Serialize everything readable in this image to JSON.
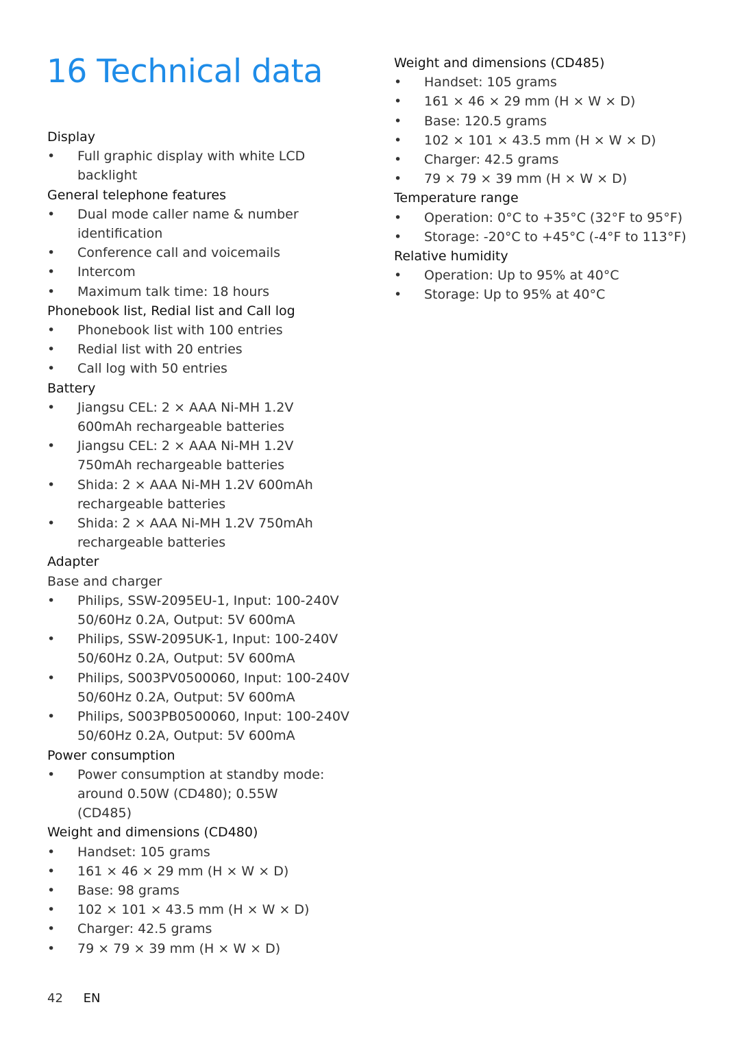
{
  "page_title": "16 Technical data",
  "left_column": [
    {
      "heading": "Display",
      "items": [
        {
          "type": "bullet",
          "text": "Full graphic display with white LCD backlight",
          "lines": [
            "Full graphic display with white LCD",
            "backlight"
          ]
        }
      ]
    },
    {
      "heading": "General telephone features",
      "items": [
        {
          "type": "bullet",
          "lines": [
            "Dual mode caller name & number",
            "identification"
          ]
        },
        {
          "type": "bullet",
          "lines": [
            "Conference call and voicemails"
          ]
        },
        {
          "type": "bullet",
          "lines": [
            "Intercom"
          ]
        },
        {
          "type": "bullet",
          "lines": [
            "Maximum talk time: 18 hours"
          ]
        }
      ]
    },
    {
      "heading": "Phonebook list, Redial list and Call log",
      "items": [
        {
          "type": "bullet",
          "lines": [
            "Phonebook list with 100 entries"
          ]
        },
        {
          "type": "bullet",
          "lines": [
            "Redial list with 20 entries"
          ]
        },
        {
          "type": "bullet",
          "lines": [
            "Call log with 50 entries"
          ]
        }
      ]
    },
    {
      "heading": "Battery",
      "items": [
        {
          "type": "bullet",
          "lines": [
            "Jiangsu CEL: 2 × AAA Ni-MH 1.2V",
            "600mAh rechargeable batteries"
          ]
        },
        {
          "type": "bullet",
          "lines": [
            "Jiangsu CEL: 2 × AAA Ni-MH 1.2V",
            "750mAh rechargeable batteries"
          ]
        },
        {
          "type": "bullet",
          "lines": [
            "Shida: 2 × AAA Ni-MH 1.2V 600mAh",
            "rechargeable batteries"
          ]
        },
        {
          "type": "bullet",
          "lines": [
            "Shida: 2 × AAA Ni-MH 1.2V 750mAh",
            "rechargeable batteries"
          ]
        }
      ]
    },
    {
      "heading": "Adapter",
      "items": [
        {
          "type": "plain",
          "lines": [
            "Base and charger"
          ]
        },
        {
          "type": "bullet",
          "lines": [
            "Philips, SSW-2095EU-1, Input: 100-240V",
            "50/60Hz 0.2A, Output: 5V 600mA"
          ]
        },
        {
          "type": "bullet",
          "lines": [
            "Philips, SSW-2095UK-1, Input: 100-240V",
            "50/60Hz 0.2A, Output: 5V 600mA"
          ]
        },
        {
          "type": "bullet",
          "lines": [
            "Philips, S003PV0500060, Input: 100-240V",
            "50/60Hz 0.2A, Output: 5V 600mA"
          ]
        },
        {
          "type": "bullet",
          "lines": [
            "Philips, S003PB0500060, Input: 100-240V",
            "50/60Hz 0.2A, Output: 5V 600mA"
          ]
        }
      ]
    },
    {
      "heading": "Power consumption",
      "items": [
        {
          "type": "bullet",
          "lines": [
            "Power consumption at standby mode:",
            "around 0.50W (CD480); 0.55W",
            "(CD485)"
          ]
        }
      ]
    },
    {
      "heading": "Weight and dimensions (CD480)",
      "items": [
        {
          "type": "bullet",
          "lines": [
            "Handset: 105 grams"
          ]
        },
        {
          "type": "bullet",
          "lines": [
            "161 × 46 × 29 mm (H × W × D)"
          ]
        },
        {
          "type": "bullet",
          "lines": [
            "Base: 98 grams"
          ]
        },
        {
          "type": "bullet",
          "lines": [
            "102 × 101 × 43.5 mm (H × W × D)"
          ]
        },
        {
          "type": "bullet",
          "lines": [
            "Charger: 42.5 grams"
          ]
        },
        {
          "type": "bullet",
          "lines": [
            "79 × 79 × 39 mm (H × W × D)"
          ]
        }
      ]
    }
  ],
  "right_column": [
    {
      "heading": "Weight and dimensions (CD485)",
      "items": [
        {
          "type": "bullet",
          "lines": [
            "Handset: 105 grams"
          ]
        },
        {
          "type": "bullet",
          "lines": [
            "161 × 46 × 29 mm (H × W × D)"
          ]
        },
        {
          "type": "bullet",
          "lines": [
            "Base: 120.5 grams"
          ]
        },
        {
          "type": "bullet",
          "lines": [
            "102 × 101 × 43.5 mm (H × W × D)"
          ]
        },
        {
          "type": "bullet",
          "lines": [
            "Charger: 42.5 grams"
          ]
        },
        {
          "type": "bullet",
          "lines": [
            "79 × 79 × 39 mm (H × W × D)"
          ]
        }
      ]
    },
    {
      "heading": "Temperature range",
      "items": [
        {
          "type": "bullet",
          "lines": [
            "Operation: 0°C to +35°C (32°F to 95°F)"
          ]
        },
        {
          "type": "bullet",
          "lines": [
            "Storage: -20°C to +45°C (-4°F to 113°F)"
          ]
        }
      ]
    },
    {
      "heading": "Relative humidity",
      "items": [
        {
          "type": "bullet",
          "lines": [
            "Operation: Up to 95% at 40°C"
          ]
        },
        {
          "type": "bullet",
          "lines": [
            "Storage: Up to 95% at 40°C"
          ]
        }
      ]
    }
  ],
  "bullet_char": "•",
  "footer": {
    "page_number": "42",
    "language": "EN"
  },
  "colors": {
    "title": "#1e8ce8",
    "text": "#333333"
  }
}
